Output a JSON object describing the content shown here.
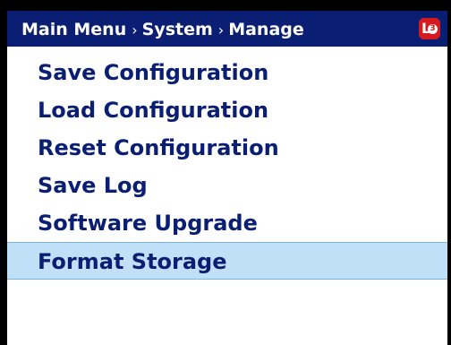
{
  "header": {
    "crumbs": [
      "Main Menu",
      "System",
      "Manage"
    ],
    "separator": "›",
    "logo": {
      "letter": "L",
      "digit": "3",
      "color": "#d71920"
    }
  },
  "menu": {
    "items": [
      {
        "label": "Save Configuration",
        "selected": false
      },
      {
        "label": "Load Configuration",
        "selected": false
      },
      {
        "label": "Reset Configuration",
        "selected": false
      },
      {
        "label": "Save Log",
        "selected": false
      },
      {
        "label": "Software Upgrade",
        "selected": false
      },
      {
        "label": "Format Storage",
        "selected": true
      }
    ]
  },
  "colors": {
    "header_bg": "#0a1f73",
    "text": "#0a1f73",
    "selected_bg": "#bfe0f7",
    "background": "#ffffff"
  }
}
